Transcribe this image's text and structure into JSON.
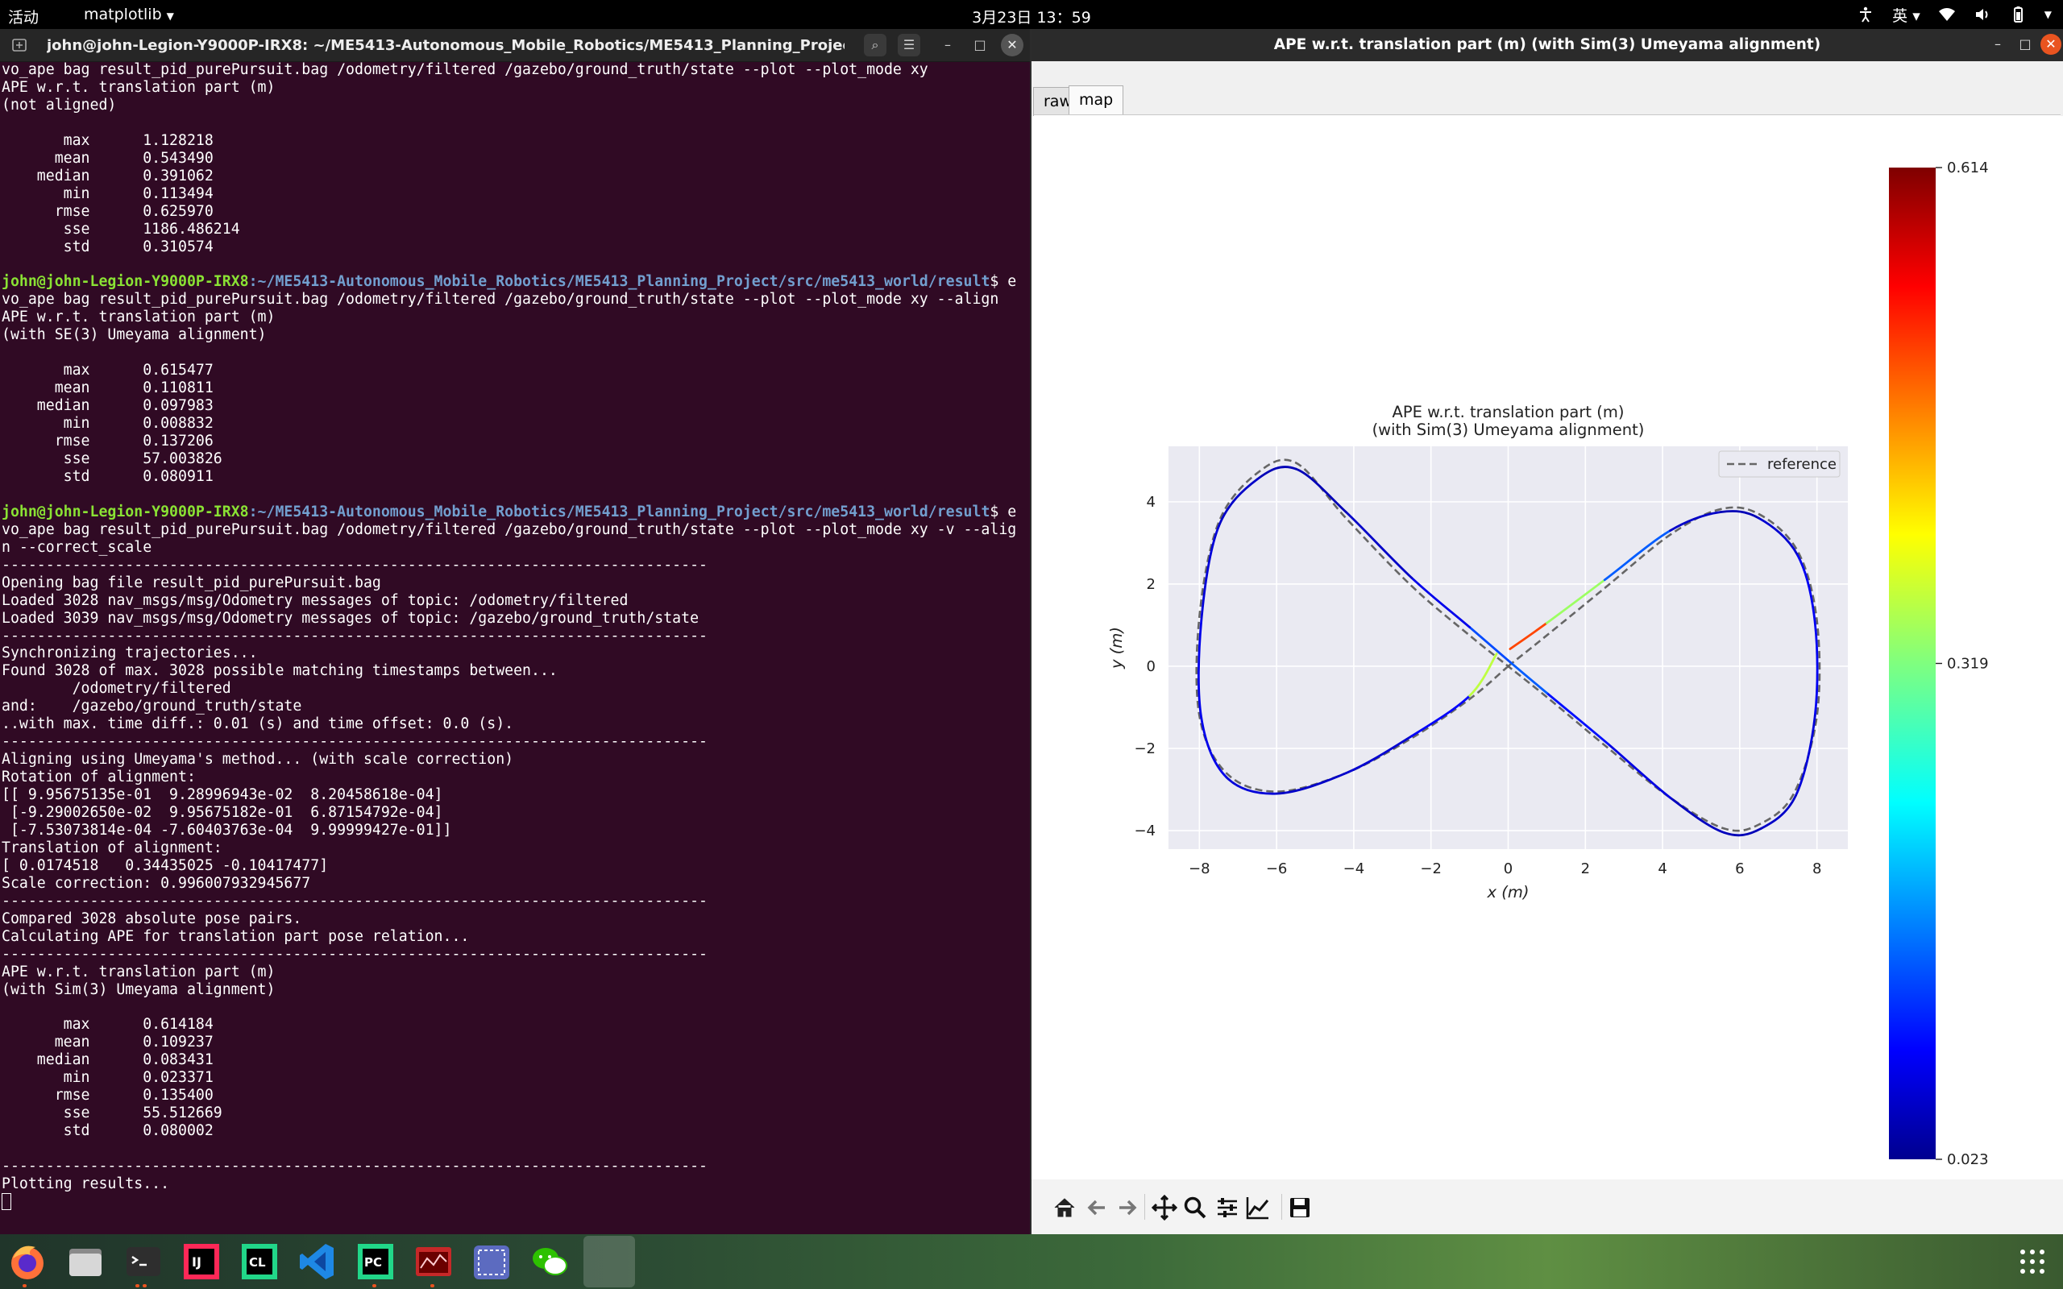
{
  "topbar": {
    "activities": "活动",
    "app_menu": "matplotlib",
    "clock": "3月23日 13：59",
    "input_method": "英"
  },
  "terminal": {
    "title": "john@john-Legion-Y9000P-IRX8: ~/ME5413-Autonomous_Mobile_Robotics/ME5413_Planning_Project/src/me541...",
    "prompt_user": "john@john-Legion-Y9000P-IRX8",
    "prompt_path": ":~/ME5413-Autonomous_Mobile_Robotics/ME5413_Planning_Project/src/me5413_world/result",
    "lines": [
      {
        "t": "vo_ape bag result_pid_purePursuit.bag /odometry/filtered /gazebo/ground_truth/state --plot --plot_mode xy"
      },
      {
        "t": "APE w.r.t. translation part (m)"
      },
      {
        "t": "(not aligned)"
      },
      {
        "t": ""
      },
      {
        "t": "       max      1.128218"
      },
      {
        "t": "      mean      0.543490"
      },
      {
        "t": "    median      0.391062"
      },
      {
        "t": "       min      0.113494"
      },
      {
        "t": "      rmse      0.625970"
      },
      {
        "t": "       sse      1186.486214"
      },
      {
        "t": "       std      0.310574"
      },
      {
        "t": ""
      },
      {
        "p": true,
        "t": "$ e"
      },
      {
        "t": "vo_ape bag result_pid_purePursuit.bag /odometry/filtered /gazebo/ground_truth/state --plot --plot_mode xy --align"
      },
      {
        "t": "APE w.r.t. translation part (m)"
      },
      {
        "t": "(with SE(3) Umeyama alignment)"
      },
      {
        "t": ""
      },
      {
        "t": "       max      0.615477"
      },
      {
        "t": "      mean      0.110811"
      },
      {
        "t": "    median      0.097983"
      },
      {
        "t": "       min      0.008832"
      },
      {
        "t": "      rmse      0.137206"
      },
      {
        "t": "       sse      57.003826"
      },
      {
        "t": "       std      0.080911"
      },
      {
        "t": ""
      },
      {
        "p": true,
        "t": "$ e"
      },
      {
        "t": "vo_ape bag result_pid_purePursuit.bag /odometry/filtered /gazebo/ground_truth/state --plot --plot_mode xy -v --alig"
      },
      {
        "t": "n --correct_scale"
      },
      {
        "t": "--------------------------------------------------------------------------------"
      },
      {
        "t": "Opening bag file result_pid_purePursuit.bag"
      },
      {
        "t": "Loaded 3028 nav_msgs/msg/Odometry messages of topic: /odometry/filtered"
      },
      {
        "t": "Loaded 3039 nav_msgs/msg/Odometry messages of topic: /gazebo/ground_truth/state"
      },
      {
        "t": "--------------------------------------------------------------------------------"
      },
      {
        "t": "Synchronizing trajectories..."
      },
      {
        "t": "Found 3028 of max. 3028 possible matching timestamps between..."
      },
      {
        "t": "        /odometry/filtered"
      },
      {
        "t": "and:    /gazebo/ground_truth/state"
      },
      {
        "t": "..with max. time diff.: 0.01 (s) and time offset: 0.0 (s)."
      },
      {
        "t": "--------------------------------------------------------------------------------"
      },
      {
        "t": "Aligning using Umeyama's method... (with scale correction)"
      },
      {
        "t": "Rotation of alignment:"
      },
      {
        "t": "[[ 9.95675135e-01  9.28996943e-02  8.20458618e-04]"
      },
      {
        "t": " [-9.29002650e-02  9.95675182e-01  6.87154792e-04]"
      },
      {
        "t": " [-7.53073814e-04 -7.60403763e-04  9.99999427e-01]]"
      },
      {
        "t": "Translation of alignment:"
      },
      {
        "t": "[ 0.0174518   0.34435025 -0.10417477]"
      },
      {
        "t": "Scale correction: 0.996007932945677"
      },
      {
        "t": "--------------------------------------------------------------------------------"
      },
      {
        "t": "Compared 3028 absolute pose pairs."
      },
      {
        "t": "Calculating APE for translation part pose relation..."
      },
      {
        "t": "--------------------------------------------------------------------------------"
      },
      {
        "t": "APE w.r.t. translation part (m)"
      },
      {
        "t": "(with Sim(3) Umeyama alignment)"
      },
      {
        "t": ""
      },
      {
        "t": "       max      0.614184"
      },
      {
        "t": "      mean      0.109237"
      },
      {
        "t": "    median      0.083431"
      },
      {
        "t": "       min      0.023371"
      },
      {
        "t": "      rmse      0.135400"
      },
      {
        "t": "       sse      55.512669"
      },
      {
        "t": "       std      0.080002"
      },
      {
        "t": ""
      },
      {
        "t": "--------------------------------------------------------------------------------"
      },
      {
        "t": "Plotting results..."
      }
    ]
  },
  "plot_window": {
    "title": "APE w.r.t. translation part (m) (with Sim(3) Umeyama alignment)",
    "tabs": [
      {
        "label": "raw",
        "active": false
      },
      {
        "label": "map",
        "active": true
      }
    ],
    "toolbar": [
      "home-icon",
      "back-icon",
      "forward-icon",
      "pan-icon",
      "zoom-icon",
      "configure-subplots-icon",
      "edit-axis-icon",
      "save-icon"
    ]
  },
  "chart_data": {
    "type": "line",
    "title": "APE w.r.t. translation part (m)",
    "subtitle": "(with Sim(3) Umeyama alignment)",
    "xlabel": "x (m)",
    "ylabel": "y (m)",
    "xlim": [
      -8.8,
      8.8
    ],
    "ylim": [
      -4.45,
      5.35
    ],
    "xticks": [
      -8,
      -6,
      -4,
      -2,
      0,
      2,
      4,
      6,
      8
    ],
    "yticks": [
      -4,
      -2,
      0,
      2,
      4
    ],
    "grid": true,
    "legend": {
      "position": "top-right",
      "entries": [
        "reference"
      ]
    },
    "series": [
      {
        "name": "reference",
        "style": "dashed",
        "color": "#666666",
        "points": [
          [
            0,
            0
          ],
          [
            1,
            0.75
          ],
          [
            2.5,
            1.9
          ],
          [
            4.2,
            3.2
          ],
          [
            5.5,
            3.82
          ],
          [
            6.5,
            3.7
          ],
          [
            7.5,
            2.8
          ],
          [
            8,
            1.1
          ],
          [
            8,
            -1.2
          ],
          [
            7.4,
            -3.1
          ],
          [
            6.5,
            -3.85
          ],
          [
            5.6,
            -3.95
          ],
          [
            4.2,
            -3.2
          ],
          [
            2.6,
            -2
          ],
          [
            1,
            -0.75
          ],
          [
            0,
            0
          ],
          [
            -1,
            0.75
          ],
          [
            -2.5,
            1.95
          ],
          [
            -4.2,
            3.6
          ],
          [
            -5.5,
            4.95
          ],
          [
            -6.5,
            4.7
          ],
          [
            -7.5,
            3.5
          ],
          [
            -8,
            1.2
          ],
          [
            -8,
            -1.2
          ],
          [
            -7.3,
            -2.6
          ],
          [
            -6,
            -3.05
          ],
          [
            -4.2,
            -2.6
          ],
          [
            -2.5,
            -1.75
          ],
          [
            -1,
            -0.8
          ],
          [
            0,
            0
          ]
        ]
      },
      {
        "name": "",
        "style": "solid",
        "colormap": "jet",
        "points": [
          [
            0.05,
            0.42
          ],
          [
            1,
            1.05
          ],
          [
            2.5,
            2.1
          ],
          [
            4.2,
            3.3
          ],
          [
            5.5,
            3.75
          ],
          [
            6.5,
            3.6
          ],
          [
            7.5,
            2.7
          ],
          [
            7.95,
            1.05
          ],
          [
            7.95,
            -1.2
          ],
          [
            7.45,
            -3.15
          ],
          [
            6.55,
            -3.95
          ],
          [
            5.6,
            -4.05
          ],
          [
            4.2,
            -3.2
          ],
          [
            2.6,
            -1.9
          ],
          [
            1,
            -0.65
          ],
          [
            0.05,
            0.1
          ],
          [
            -1,
            0.95
          ],
          [
            -2.5,
            2.15
          ],
          [
            -4.2,
            3.75
          ],
          [
            -5.5,
            4.8
          ],
          [
            -6.5,
            4.55
          ],
          [
            -7.5,
            3.4
          ],
          [
            -7.95,
            1.1
          ],
          [
            -7.95,
            -1.25
          ],
          [
            -7.3,
            -2.7
          ],
          [
            -6,
            -3.1
          ],
          [
            -4.2,
            -2.6
          ],
          [
            -2.5,
            -1.7
          ],
          [
            -1,
            -0.72
          ],
          [
            -0.3,
            0.3
          ]
        ],
        "error": [
          0.55,
          0.45,
          0.22,
          0.08,
          0.05,
          0.06,
          0.08,
          0.1,
          0.08,
          0.07,
          0.06,
          0.05,
          0.07,
          0.09,
          0.12,
          0.18,
          0.1,
          0.07,
          0.06,
          0.05,
          0.06,
          0.07,
          0.08,
          0.09,
          0.08,
          0.07,
          0.06,
          0.08,
          0.11,
          0.6
        ]
      }
    ],
    "colorbar": {
      "min": 0.023,
      "max": 0.614,
      "ticks": [
        "0.614",
        "0.319",
        "0.023"
      ]
    }
  },
  "colors": {
    "terminal_bg": "#300a24",
    "prompt_user": "#8ae234",
    "prompt_path": "#729fcf",
    "plot_bg": "#eaeaf2",
    "ubuntu_orange": "#e95420"
  },
  "dock": [
    "firefox-icon",
    "files-icon",
    "terminal-icon",
    "intellij-icon",
    "clion-icon",
    "vscode-icon",
    "pycharm-icon",
    "matplotlib-icon",
    "screenshot-icon",
    "wechat-icon",
    "active-window-icon"
  ]
}
